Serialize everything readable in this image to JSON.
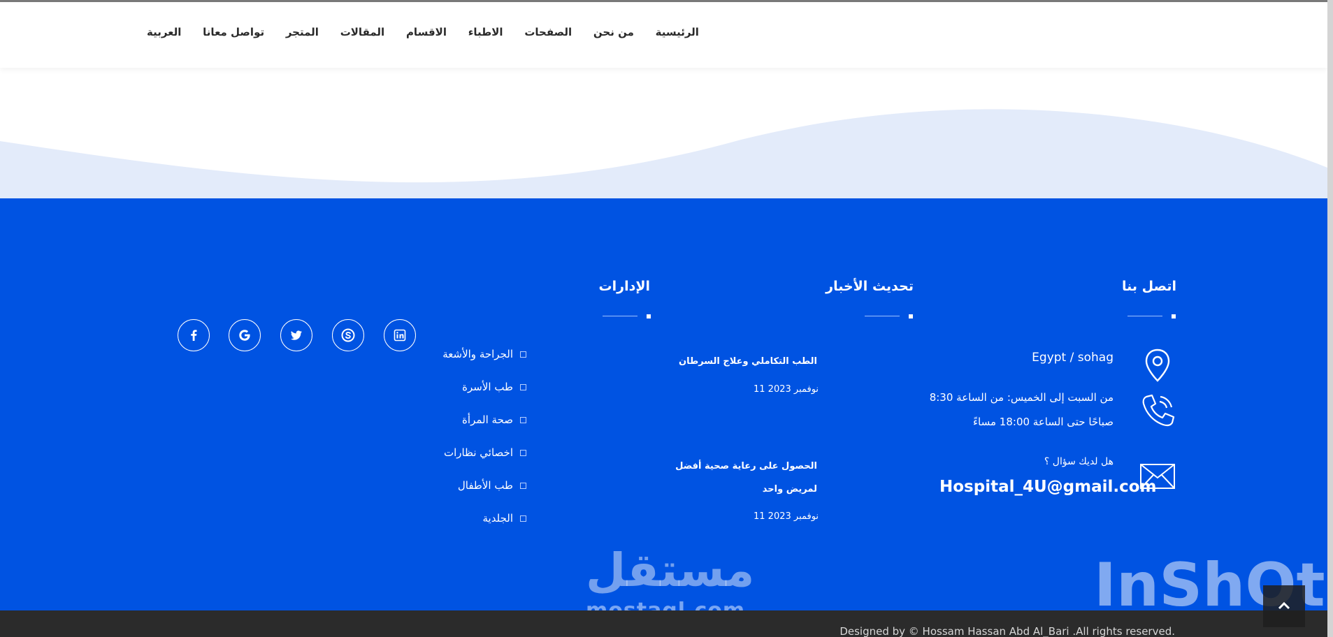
{
  "navbar": {
    "items": [
      "الرئيسية",
      "من نحن",
      "الصفحات",
      "الاطباء",
      "الاقسام",
      "المقالات",
      "المتجر",
      "تواصل معانا",
      "العربية"
    ]
  },
  "footer": {
    "contact": {
      "title": "اتصل بنا",
      "location": "Egypt / sohag",
      "hours_line1": "من السبت إلى الخميس: من الساعة 8:30",
      "hours_line2": "صباحًا حتى الساعة 18:00 مساءً",
      "question": "هل لديك سؤال ؟",
      "email": "Hospital_4U@gmail.com",
      "icons": [
        "location-pin-icon",
        "phone-icon",
        "envelope-icon"
      ]
    },
    "news": {
      "title": "تحديث الأخبار",
      "items": [
        {
          "title_line1": "الطب التكاملي وعلاج السرطان",
          "title_line2": "",
          "date": "11 2023 نوفمبر"
        },
        {
          "title_line1": "الحصول على رعاية صحية أفضل",
          "title_line2": "لمريض واحد",
          "date": "11 2023 نوفمبر"
        }
      ]
    },
    "departments": {
      "title": "الإدارات",
      "items": [
        "الجراحة والأشعة",
        "طب الأسرة",
        "صحة المرأة",
        "اخصائي نظارات",
        "طب الأطفال",
        "الجلدية"
      ]
    },
    "social": [
      "facebook-icon",
      "google-icon",
      "twitter-icon",
      "skype-icon",
      "linkedin-icon"
    ],
    "copyright": "Designed by © Hossam Hassan Abd Al_Bari .All rights reserved."
  },
  "watermarks": {
    "mostaql_ar": "مستقل",
    "mostaql_url": "mostaql.com",
    "inshot": "InShOt"
  },
  "colors": {
    "footer_blue": "#0053e2",
    "wave_light": "#e3ebfa",
    "bottom_bar": "#2b2b2b"
  }
}
